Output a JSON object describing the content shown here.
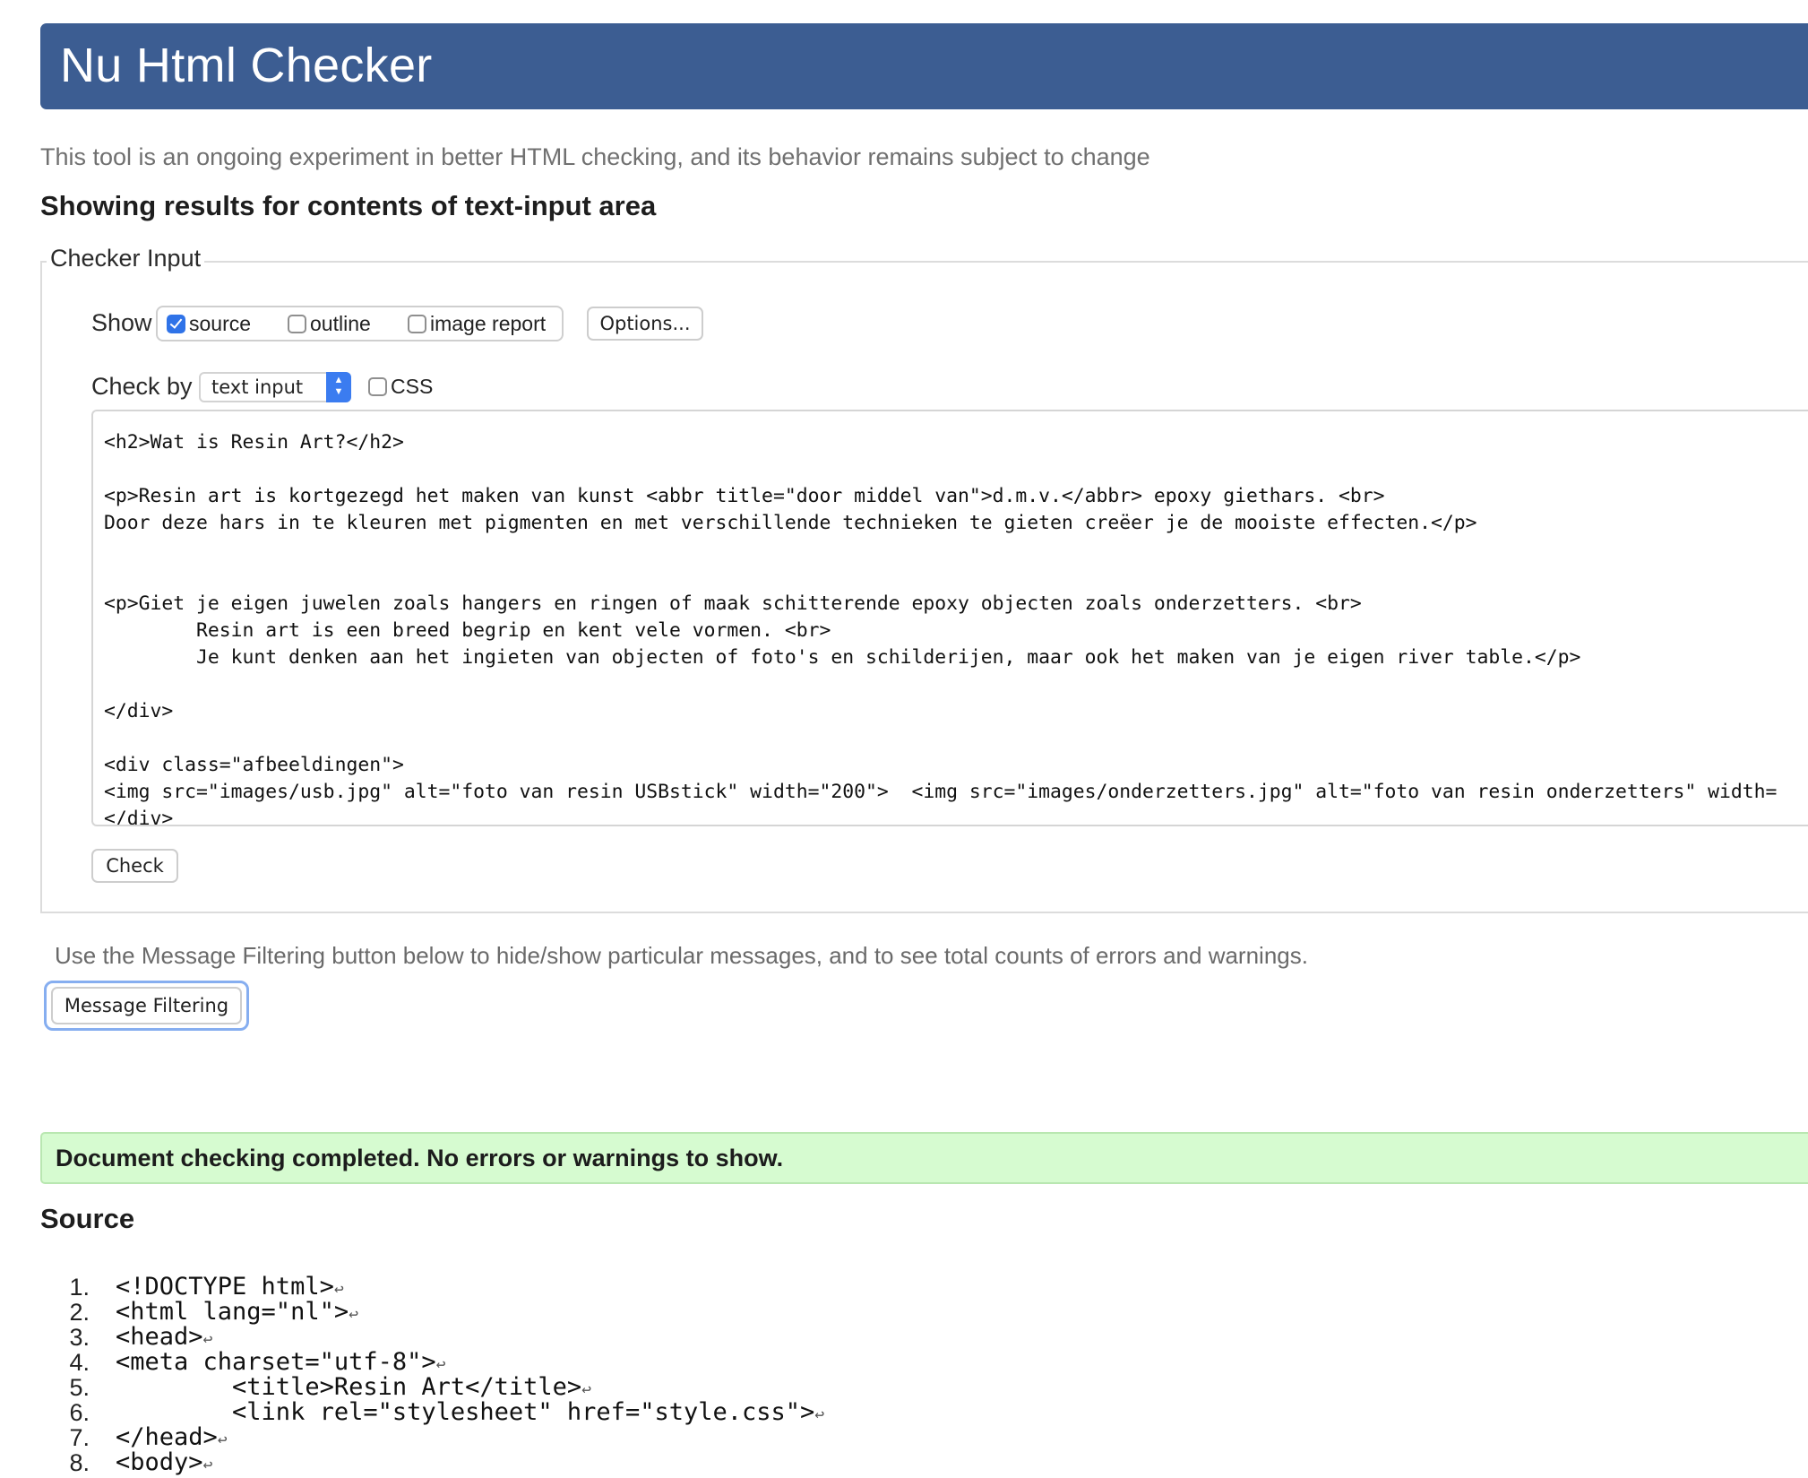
{
  "header": {
    "title": "Nu Html Checker"
  },
  "tagline": "This tool is an ongoing experiment in better HTML checking, and its behavior remains subject to change",
  "results_heading": "Showing results for contents of text-input area",
  "checker_input": {
    "legend": "Checker Input",
    "show_label": "Show",
    "show_options": [
      {
        "label": "source",
        "checked": true
      },
      {
        "label": "outline",
        "checked": false
      },
      {
        "label": "image report",
        "checked": false
      }
    ],
    "options_button": "Options...",
    "check_by_label": "Check by",
    "check_by_value": "text input",
    "css_label": "CSS",
    "css_checked": false,
    "textarea_value": "<h2>Wat is Resin Art?</h2>\n\n<p>Resin art is kortgezegd het maken van kunst <abbr title=\"door middel van\">d.m.v.</abbr> epoxy giethars. <br>\nDoor deze hars in te kleuren met pigmenten en met verschillende technieken te gieten creëer je de mooiste effecten.</p>\n\n\n<p>Giet je eigen juwelen zoals hangers en ringen of maak schitterende epoxy objecten zoals onderzetters. <br>\n        Resin art is een breed begrip en kent vele vormen. <br>\n        Je kunt denken aan het ingieten van objecten of foto's en schilderijen, maar ook het maken van je eigen river table.</p>\n\n</div>\n\n<div class=\"afbeeldingen\">\n<img src=\"images/usb.jpg\" alt=\"foto van resin USBstick\" width=\"200\">  <img src=\"images/onderzetters.jpg\" alt=\"foto van resin onderzetters\" width=\n</div>",
    "check_button": "Check"
  },
  "filter_note": "Use the Message Filtering button below to hide/show particular messages, and to see total counts of errors and warnings.",
  "message_filtering_button": "Message Filtering",
  "result_message": "Document checking completed. No errors or warnings to show.",
  "source_heading": "Source",
  "line_end_glyph": "↩",
  "source_lines": [
    {
      "num": "1.",
      "code": "<!DOCTYPE html>"
    },
    {
      "num": "2.",
      "code": "<html lang=\"nl\">"
    },
    {
      "num": "3.",
      "code": "<head>"
    },
    {
      "num": "4.",
      "code": "<meta charset=\"utf-8\">"
    },
    {
      "num": "5.",
      "code": "        <title>Resin Art</title>"
    },
    {
      "num": "6.",
      "code": "        <link rel=\"stylesheet\" href=\"style.css\">"
    },
    {
      "num": "7.",
      "code": "</head>"
    },
    {
      "num": "8.",
      "code": "<body>"
    }
  ],
  "colors": {
    "banner": "#3c5d92",
    "success_bg": "#d6fbd0",
    "checkbox_checked": "#2f73e8",
    "focus_ring": "#86aef0"
  }
}
